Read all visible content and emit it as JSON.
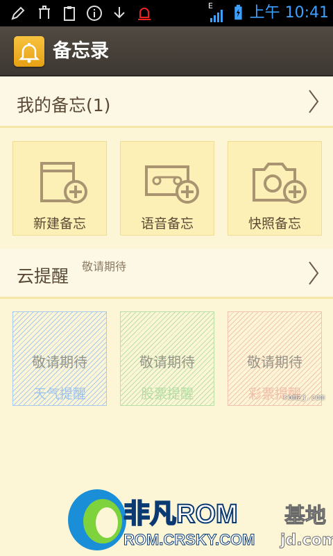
{
  "status_bar": {
    "time": "上午 10:41",
    "network": "E",
    "icons": [
      "pen-icon",
      "hanger-icon",
      "clipboard-icon",
      "info-icon",
      "download-icon",
      "alarm-icon",
      "signal-icon",
      "battery-icon"
    ]
  },
  "action_bar": {
    "title": "备忘录",
    "icon": "bell-icon"
  },
  "my_notes": {
    "title": "我的备忘(1)"
  },
  "note_actions": [
    {
      "label": "新建备忘",
      "icon": "new-note-icon"
    },
    {
      "label": "语音备忘",
      "icon": "voice-note-icon"
    },
    {
      "label": "快照备忘",
      "icon": "camera-note-icon"
    }
  ],
  "cloud": {
    "title": "云提醒",
    "note": "敬请期待"
  },
  "cloud_tiles": [
    {
      "title": "敬请期待",
      "label": "天气提醒",
      "color": "#a9c9ee",
      "label_color": "#9ec2ea"
    },
    {
      "title": "敬请期待",
      "label": "股票提醒",
      "color": "#b8e0a8",
      "label_color": "#b5dca3"
    },
    {
      "title": "敬请期待",
      "label": "彩票提醒",
      "color": "#f2c3b0",
      "label_color": "#efbea8"
    }
  ],
  "watermark": {
    "brand": "非凡ROM",
    "url": "ROM.CRSKY.COM",
    "suffix": "基地",
    "suffix_url": "jd.com",
    "corner": "romzj.com"
  },
  "colors": {
    "background": "#fdf6d6",
    "tile": "#fdf0b6",
    "accent": "#e7a013",
    "time": "#3da0ff"
  }
}
